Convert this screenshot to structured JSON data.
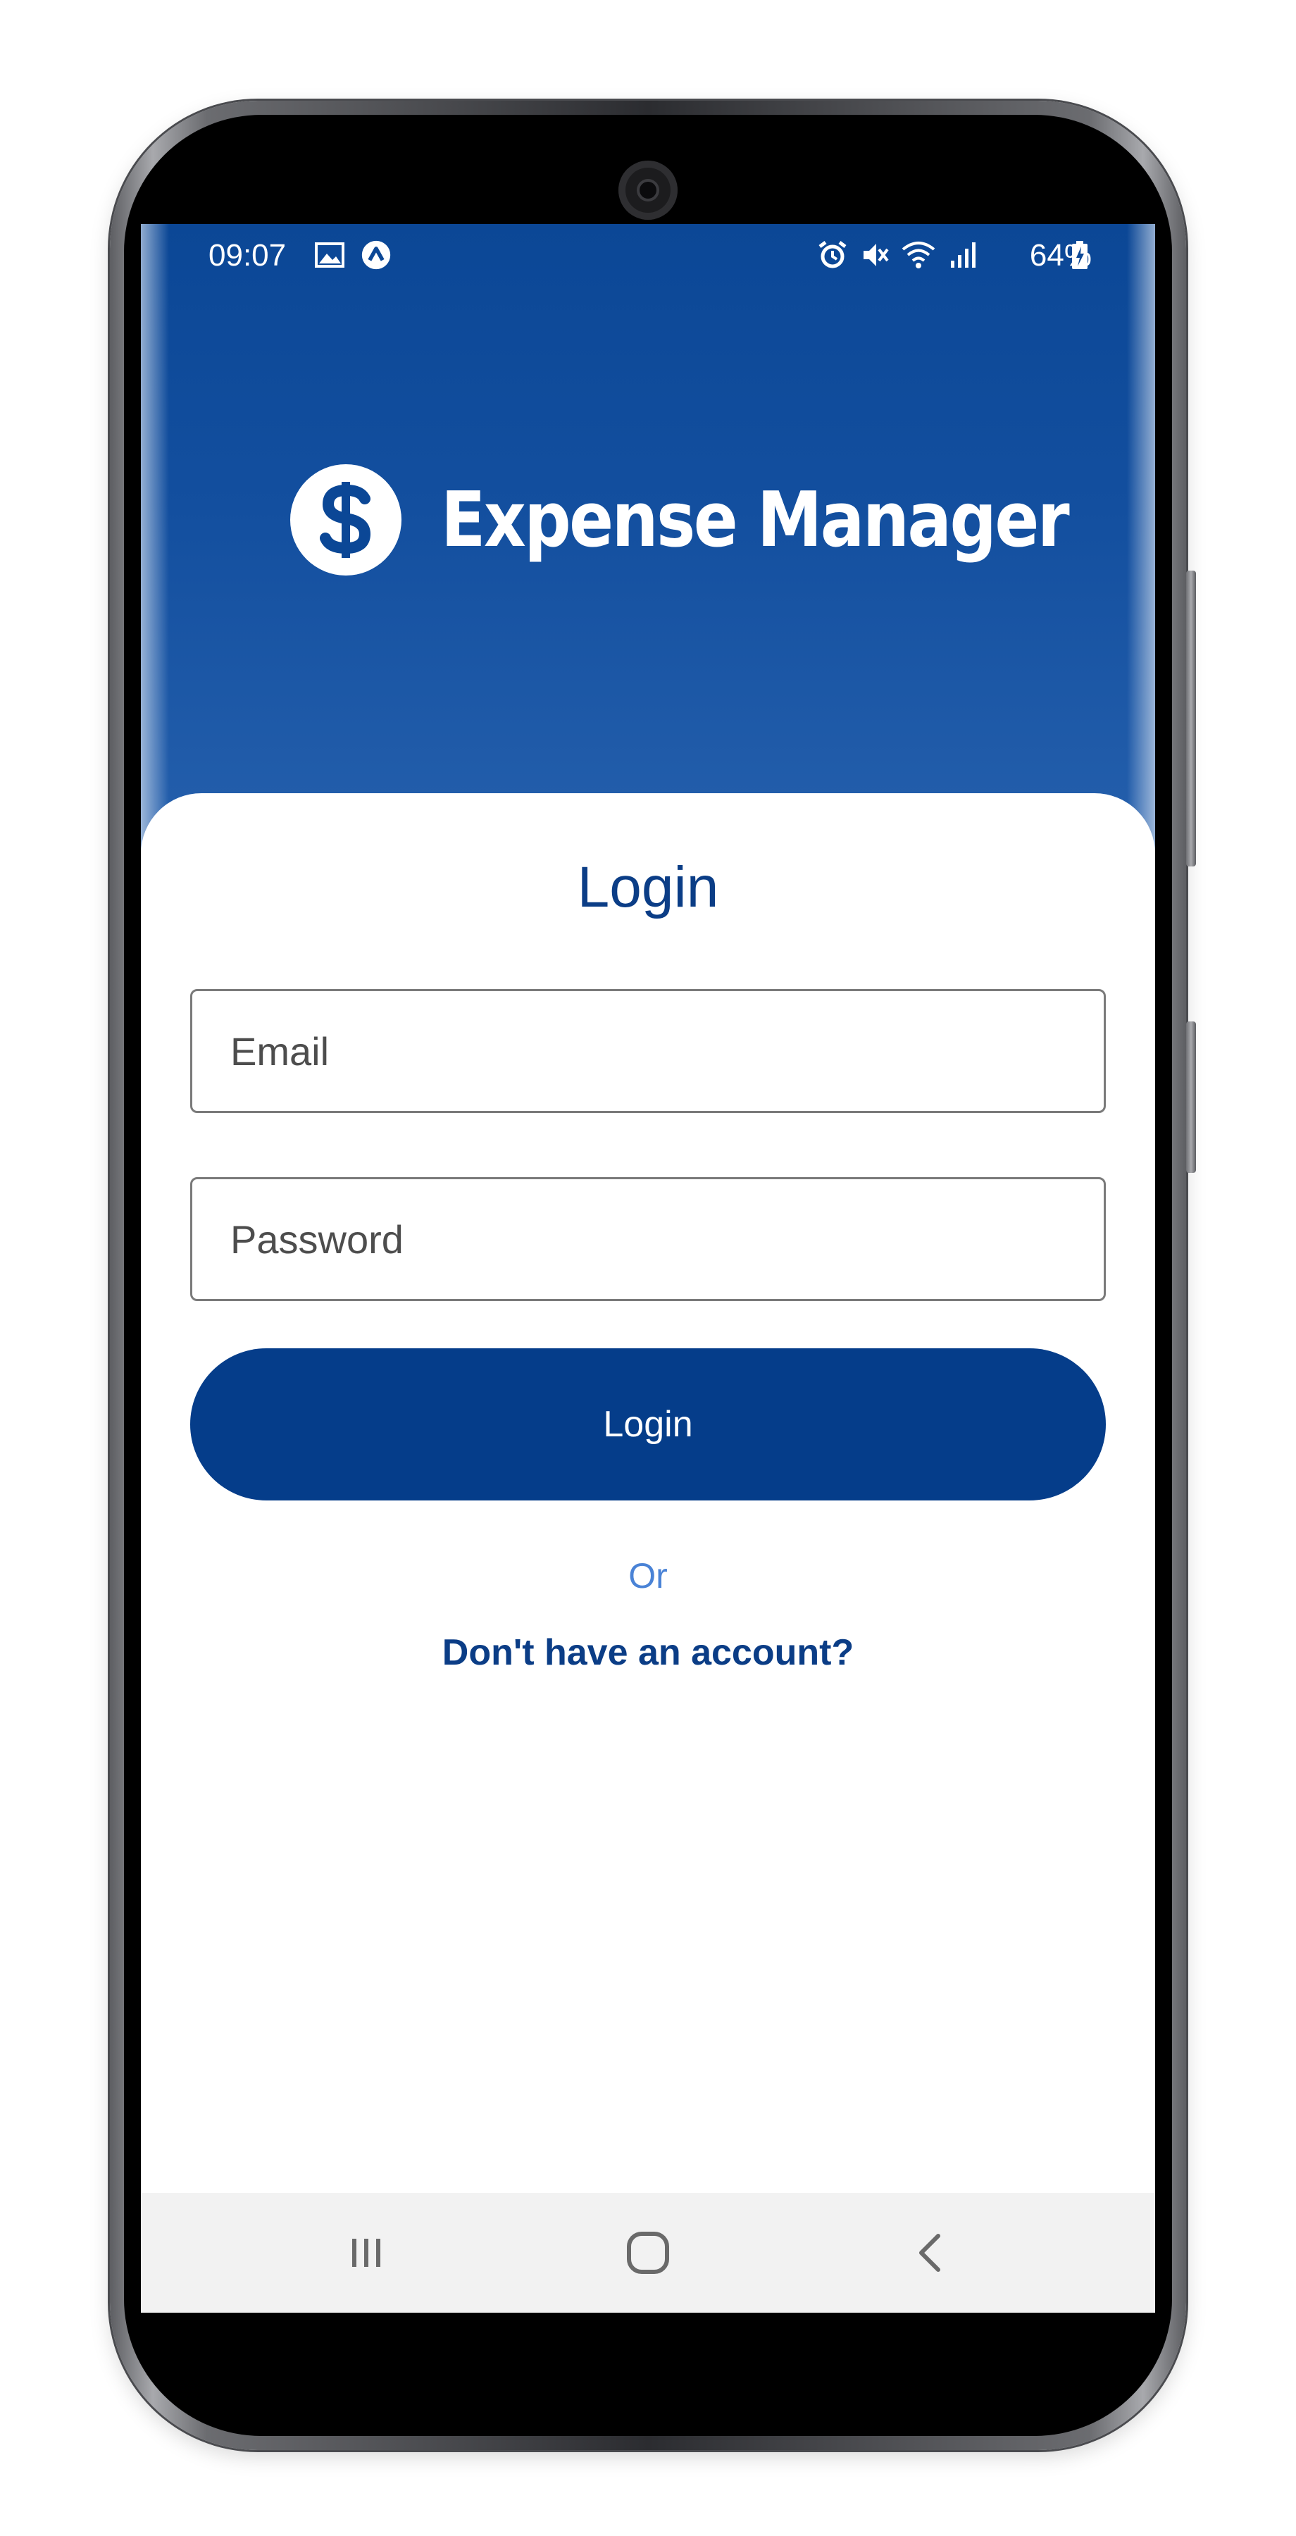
{
  "status_bar": {
    "time": "09:07",
    "battery": "64%",
    "left_icons": [
      "image-icon",
      "app-notification-icon"
    ],
    "right_icons": [
      "alarm-icon",
      "mute-icon",
      "wifi-icon",
      "signal-icon",
      "battery-charging-icon"
    ]
  },
  "app": {
    "name": "Expense Manager",
    "logo_icon": "dollar-circle-icon"
  },
  "login": {
    "title": "Login",
    "email_placeholder": "Email",
    "password_placeholder": "Password",
    "button_label": "Login",
    "or_text": "Or",
    "signup_link": "Don't have an account?"
  },
  "nav": {
    "icons": [
      "recent-apps-icon",
      "home-icon",
      "back-icon"
    ]
  },
  "colors": {
    "header_blue": "#0b4796",
    "primary": "#053d8a",
    "link_light": "#4a83d6"
  }
}
